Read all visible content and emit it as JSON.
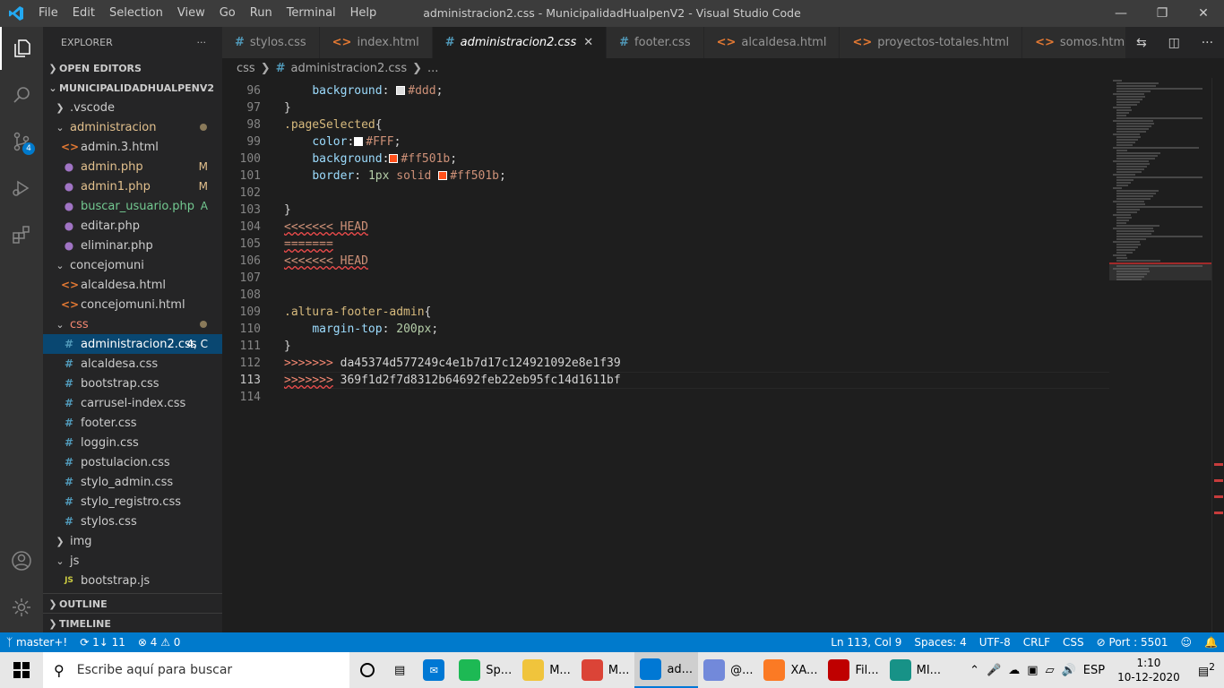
{
  "titlebar": {
    "menus": [
      "File",
      "Edit",
      "Selection",
      "View",
      "Go",
      "Run",
      "Terminal",
      "Help"
    ],
    "title": "administracion2.css - MunicipalidadHualpenV2 - Visual Studio Code"
  },
  "activitybar": {
    "scm_badge": "4"
  },
  "sidebar": {
    "title": "EXPLORER",
    "more": "···",
    "open_editors": "OPEN EDITORS",
    "project": "MUNICIPALIDADHUALPENV2",
    "tree": [
      {
        "label": ".vscode",
        "kind": "folder",
        "open": false,
        "depth": 1
      },
      {
        "label": "administracion",
        "kind": "folder",
        "open": true,
        "depth": 1,
        "dot": true,
        "tone": "mod"
      },
      {
        "label": "admin.3.html",
        "kind": "html",
        "depth": 2
      },
      {
        "label": "admin.php",
        "kind": "php",
        "depth": 2,
        "status": "M",
        "tone": "mod"
      },
      {
        "label": "admin1.php",
        "kind": "php",
        "depth": 2,
        "status": "M",
        "tone": "mod"
      },
      {
        "label": "buscar_usuario.php",
        "kind": "php",
        "depth": 2,
        "status": "A",
        "tone": "add"
      },
      {
        "label": "editar.php",
        "kind": "php",
        "depth": 2
      },
      {
        "label": "eliminar.php",
        "kind": "php",
        "depth": 2
      },
      {
        "label": "concejomuni",
        "kind": "folder",
        "open": true,
        "depth": 1
      },
      {
        "label": "alcaldesa.html",
        "kind": "html",
        "depth": 2
      },
      {
        "label": "concejomuni.html",
        "kind": "html",
        "depth": 2
      },
      {
        "label": "css",
        "kind": "folder",
        "open": true,
        "depth": 1,
        "dot": true,
        "tone": "err"
      },
      {
        "label": "administracion2.css",
        "kind": "css",
        "depth": 2,
        "status": "4, C",
        "tone": "err",
        "selected": true
      },
      {
        "label": "alcaldesa.css",
        "kind": "css",
        "depth": 2
      },
      {
        "label": "bootstrap.css",
        "kind": "css",
        "depth": 2
      },
      {
        "label": "carrusel-index.css",
        "kind": "css",
        "depth": 2
      },
      {
        "label": "footer.css",
        "kind": "css",
        "depth": 2
      },
      {
        "label": "loggin.css",
        "kind": "css",
        "depth": 2
      },
      {
        "label": "postulacion.css",
        "kind": "css",
        "depth": 2
      },
      {
        "label": "stylo_admin.css",
        "kind": "css",
        "depth": 2
      },
      {
        "label": "stylo_registro.css",
        "kind": "css",
        "depth": 2
      },
      {
        "label": "stylos.css",
        "kind": "css",
        "depth": 2
      },
      {
        "label": "img",
        "kind": "folder",
        "open": false,
        "depth": 1
      },
      {
        "label": "js",
        "kind": "folder",
        "open": true,
        "depth": 1
      },
      {
        "label": "bootstrap.js",
        "kind": "js",
        "depth": 2
      }
    ],
    "outline": "OUTLINE",
    "timeline": "TIMELINE"
  },
  "tabs": [
    {
      "label": "stylos.css",
      "kind": "css"
    },
    {
      "label": "index.html",
      "kind": "html"
    },
    {
      "label": "administracion2.css",
      "kind": "css",
      "active": true
    },
    {
      "label": "footer.css",
      "kind": "css"
    },
    {
      "label": "alcaldesa.html",
      "kind": "html"
    },
    {
      "label": "proyectos-totales.html",
      "kind": "html"
    },
    {
      "label": "somos.html",
      "kind": "html"
    }
  ],
  "breadcrumb": {
    "folder": "css",
    "file": "administracion2.css",
    "more": "..."
  },
  "editor": {
    "lines": [
      {
        "n": "96",
        "parts": [
          {
            "t": "    "
          },
          {
            "t": "background",
            "c": "prop"
          },
          {
            "t": ": "
          },
          {
            "sw": "#dddddd"
          },
          {
            "t": "#ddd",
            "c": "val"
          },
          {
            "t": ";"
          }
        ]
      },
      {
        "n": "97",
        "parts": [
          {
            "t": "}"
          }
        ]
      },
      {
        "n": "98",
        "parts": [
          {
            "t": ".pageSelected",
            "c": "sel"
          },
          {
            "t": "{"
          }
        ]
      },
      {
        "n": "99",
        "parts": [
          {
            "t": "    "
          },
          {
            "t": "color",
            "c": "prop"
          },
          {
            "t": ":"
          },
          {
            "sw": "#ffffff"
          },
          {
            "t": "#FFF",
            "c": "val"
          },
          {
            "t": ";"
          }
        ]
      },
      {
        "n": "100",
        "parts": [
          {
            "t": "    "
          },
          {
            "t": "background",
            "c": "prop"
          },
          {
            "t": ":"
          },
          {
            "sw": "#ff501b"
          },
          {
            "t": "#ff501b",
            "c": "val"
          },
          {
            "t": ";"
          }
        ]
      },
      {
        "n": "101",
        "parts": [
          {
            "t": "    "
          },
          {
            "t": "border",
            "c": "prop"
          },
          {
            "t": ": "
          },
          {
            "t": "1px",
            "c": "num"
          },
          {
            "t": " "
          },
          {
            "t": "solid",
            "c": "val"
          },
          {
            "t": " "
          },
          {
            "sw": "#ff501b"
          },
          {
            "t": "#ff501b",
            "c": "val"
          },
          {
            "t": ";"
          }
        ]
      },
      {
        "n": "102",
        "parts": []
      },
      {
        "n": "103",
        "parts": [
          {
            "t": "}"
          }
        ]
      },
      {
        "n": "104",
        "parts": [
          {
            "t": "<<<<<<< HEAD",
            "c": "val",
            "sq": true
          }
        ]
      },
      {
        "n": "105",
        "parts": [
          {
            "t": "=======",
            "c": "val",
            "sq": true
          }
        ]
      },
      {
        "n": "106",
        "parts": [
          {
            "t": "<<<<<<< HEAD",
            "c": "val",
            "sq": true
          }
        ]
      },
      {
        "n": "107",
        "parts": []
      },
      {
        "n": "108",
        "parts": []
      },
      {
        "n": "109",
        "parts": [
          {
            "t": ".altura-footer-admin",
            "c": "sel"
          },
          {
            "t": "{"
          }
        ]
      },
      {
        "n": "110",
        "parts": [
          {
            "t": "    "
          },
          {
            "t": "margin-top",
            "c": "prop"
          },
          {
            "t": ": "
          },
          {
            "t": "200px",
            "c": "num"
          },
          {
            "t": ";"
          }
        ]
      },
      {
        "n": "111",
        "parts": [
          {
            "t": "}"
          }
        ]
      },
      {
        "n": "112",
        "parts": [
          {
            "t": ">>>>>>>",
            "c": "conf"
          },
          {
            "t": " da45374d577249c4e1b7d17c124921092e8e1f39"
          }
        ]
      },
      {
        "n": "113",
        "parts": [
          {
            "t": ">>>>>>>",
            "c": "conf",
            "sq": true
          },
          {
            "t": " 369f1d2f7d8312b64692feb22eb95fc14d1611bf"
          }
        ],
        "cursor": true
      },
      {
        "n": "114",
        "parts": []
      }
    ]
  },
  "statusbar": {
    "branch": "master+!",
    "sync": "1↓ 11",
    "errors": "4",
    "warnings": "0",
    "position": "Ln 113, Col 9",
    "spaces": "Spaces: 4",
    "encoding": "UTF-8",
    "eol": "CRLF",
    "language": "CSS",
    "port": "Port : 5501"
  },
  "taskbar": {
    "search_placeholder": "Escribe aquí para buscar",
    "apps": [
      {
        "label": "Sp...",
        "icon": "spotify-icon",
        "color": "#1db954"
      },
      {
        "label": "M...",
        "icon": "folder-icon",
        "color": "#f0c43c"
      },
      {
        "label": "M...",
        "icon": "chrome-icon",
        "color": "#db4437"
      },
      {
        "label": "ad...",
        "icon": "vscode-icon",
        "color": "#0078d4",
        "active": true
      },
      {
        "label": "@...",
        "icon": "discord-icon",
        "color": "#7289da"
      },
      {
        "label": "XA...",
        "icon": "xampp-icon",
        "color": "#fb7a24"
      },
      {
        "label": "Fil...",
        "icon": "filezilla-icon",
        "color": "#bf0000"
      },
      {
        "label": "MI...",
        "icon": "gitkraken-icon",
        "color": "#179287"
      }
    ],
    "lang": "ESP",
    "time": "1:10",
    "date": "10-12-2020",
    "notifications": "2"
  },
  "colors": {
    "accent": "#007acc",
    "editor_bg": "#1e1e1e",
    "sidebar_bg": "#252526"
  }
}
